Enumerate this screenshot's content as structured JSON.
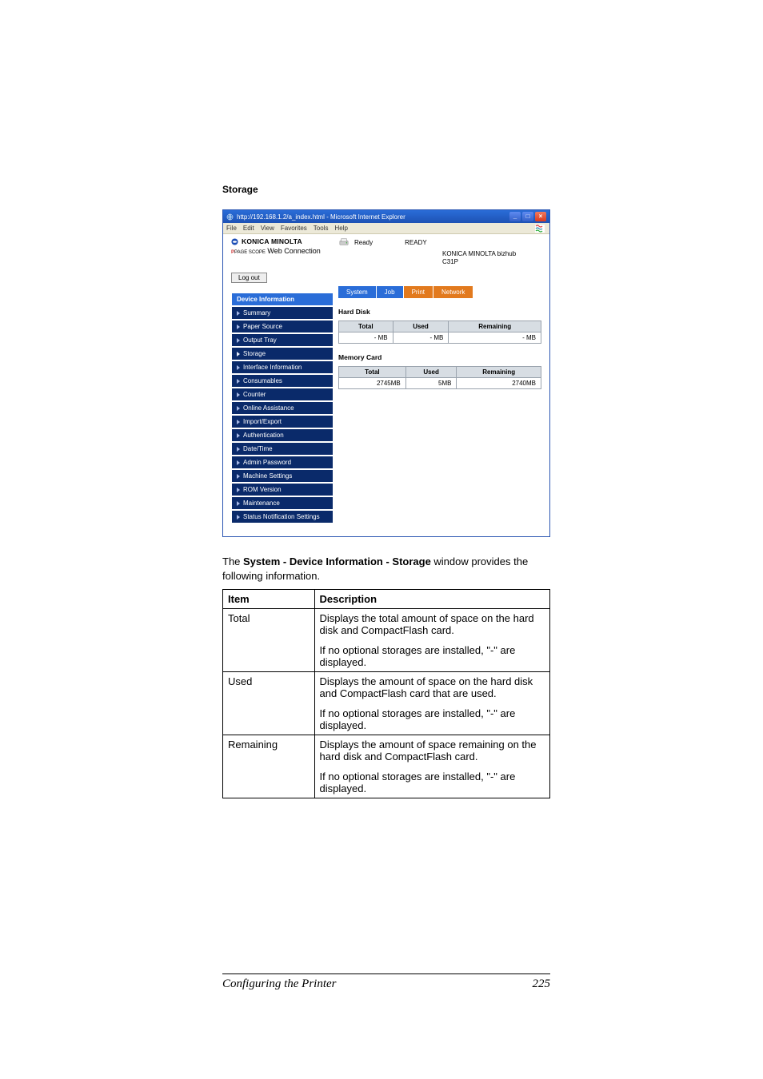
{
  "section_title": "Storage",
  "browser": {
    "title": "http://192.168.1.2/a_index.html - Microsoft Internet Explorer",
    "menus": [
      "File",
      "Edit",
      "View",
      "Favorites",
      "Tools",
      "Help"
    ]
  },
  "brand": {
    "name": "KONICA MINOLTA",
    "sub_prefix": "PAGE SCOPE",
    "sub_rest": " Web Connection"
  },
  "status": {
    "icon_label": "Ready",
    "value": "READY"
  },
  "device": {
    "line1": "KONICA MINOLTA bizhub",
    "line2": "C31P"
  },
  "logout": "Log out",
  "tabs": [
    "System",
    "Job",
    "Print",
    "Network"
  ],
  "nav": {
    "header": "Device Information",
    "items": [
      "Summary",
      "Paper Source",
      "Output Tray",
      "Storage",
      "Interface Information",
      "Consumables",
      "Counter",
      "Online Assistance",
      "Import/Export",
      "Authentication",
      "Date/Time",
      "Admin Password",
      "Machine Settings",
      "ROM Version",
      "Maintenance",
      "Status Notification Settings"
    ]
  },
  "storage": {
    "hd_title": "Hard Disk",
    "mc_title": "Memory Card",
    "cols": {
      "total": "Total",
      "used": "Used",
      "remaining": "Remaining"
    },
    "hd": {
      "total": "- MB",
      "used": "- MB",
      "remaining": "- MB"
    },
    "mc": {
      "total": "2745MB",
      "used": "5MB",
      "remaining": "2740MB"
    }
  },
  "body_text": {
    "prefix": "The ",
    "bold": "System - Device Information - Storage",
    "suffix": " window provides the following information."
  },
  "desc_table": {
    "headers": {
      "item": "Item",
      "desc": "Description"
    },
    "rows": [
      {
        "item": "Total",
        "p1": "Displays the total amount of space on the hard disk and CompactFlash card.",
        "p2": "If no optional storages are installed, \"-\" are displayed."
      },
      {
        "item": "Used",
        "p1": "Displays the amount of space on the hard disk and CompactFlash card that are used.",
        "p2": "If no optional storages are installed, \"-\" are displayed."
      },
      {
        "item": "Remaining",
        "p1": "Displays the amount of space remaining on the hard disk and CompactFlash card.",
        "p2": "If no optional storages are installed, \"-\" are displayed."
      }
    ]
  },
  "footer": {
    "title": "Configuring the Printer",
    "page": "225"
  }
}
